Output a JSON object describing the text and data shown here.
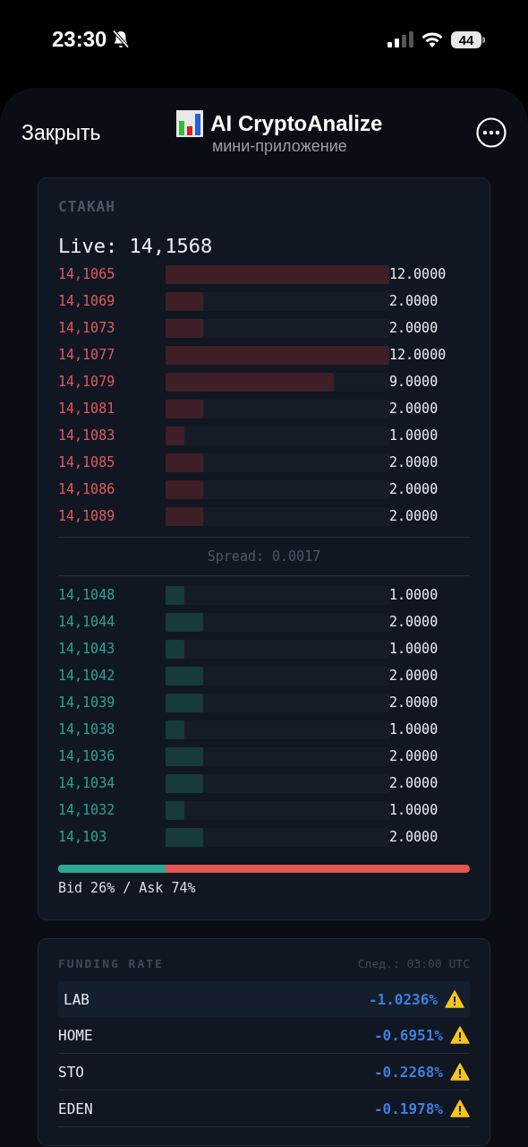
{
  "status_bar": {
    "time": "23:30",
    "silent": true,
    "battery": "44"
  },
  "header": {
    "close": "Закрыть",
    "title": "AI CryptoAnalize",
    "subtitle": "мини-приложение"
  },
  "order_book": {
    "title": "СТАКАН",
    "live": "Live: 14,1568",
    "asks": [
      {
        "price": "14,1065",
        "qty": "12.0000",
        "level": 1
      },
      {
        "price": "14,1069",
        "qty": "2.0000",
        "level": 0.1667
      },
      {
        "price": "14,1073",
        "qty": "2.0000",
        "level": 0.1667
      },
      {
        "price": "14,1077",
        "qty": "12.0000",
        "level": 1
      },
      {
        "price": "14,1079",
        "qty": "9.0000",
        "level": 0.75
      },
      {
        "price": "14,1081",
        "qty": "2.0000",
        "level": 0.1667
      },
      {
        "price": "14,1083",
        "qty": "1.0000",
        "level": 0.0833
      },
      {
        "price": "14,1085",
        "qty": "2.0000",
        "level": 0.1667
      },
      {
        "price": "14,1086",
        "qty": "2.0000",
        "level": 0.1667
      },
      {
        "price": "14,1089",
        "qty": "2.0000",
        "level": 0.1667
      }
    ],
    "spread": "Spread: 0.0017",
    "bids": [
      {
        "price": "14,1048",
        "qty": "1.0000",
        "level": 0.0833
      },
      {
        "price": "14,1044",
        "qty": "2.0000",
        "level": 0.1667
      },
      {
        "price": "14,1043",
        "qty": "1.0000",
        "level": 0.0833
      },
      {
        "price": "14,1042",
        "qty": "2.0000",
        "level": 0.1667
      },
      {
        "price": "14,1039",
        "qty": "2.0000",
        "level": 0.1667
      },
      {
        "price": "14,1038",
        "qty": "1.0000",
        "level": 0.0833
      },
      {
        "price": "14,1036",
        "qty": "2.0000",
        "level": 0.1667
      },
      {
        "price": "14,1034",
        "qty": "2.0000",
        "level": 0.1667
      },
      {
        "price": "14,1032",
        "qty": "1.0000",
        "level": 0.0833
      },
      {
        "price": "14,103",
        "qty": "2.0000",
        "level": 0.1667
      }
    ],
    "ratio": {
      "level": 0.26,
      "label": "Bid 26% / Ask 74%"
    }
  },
  "funding": {
    "title": "FUNDING RATE",
    "next": "След.: 03:00 UTC",
    "rows": [
      {
        "symbol": "LAB",
        "rate": "-1.0236%",
        "warning": true,
        "selected": true
      },
      {
        "symbol": "HOME",
        "rate": "-0.6951%",
        "warning": true,
        "selected": false
      },
      {
        "symbol": "STO",
        "rate": "-0.2268%",
        "warning": true,
        "selected": false
      },
      {
        "symbol": "EDEN",
        "rate": "-0.1978%",
        "warning": true,
        "selected": false
      }
    ]
  }
}
